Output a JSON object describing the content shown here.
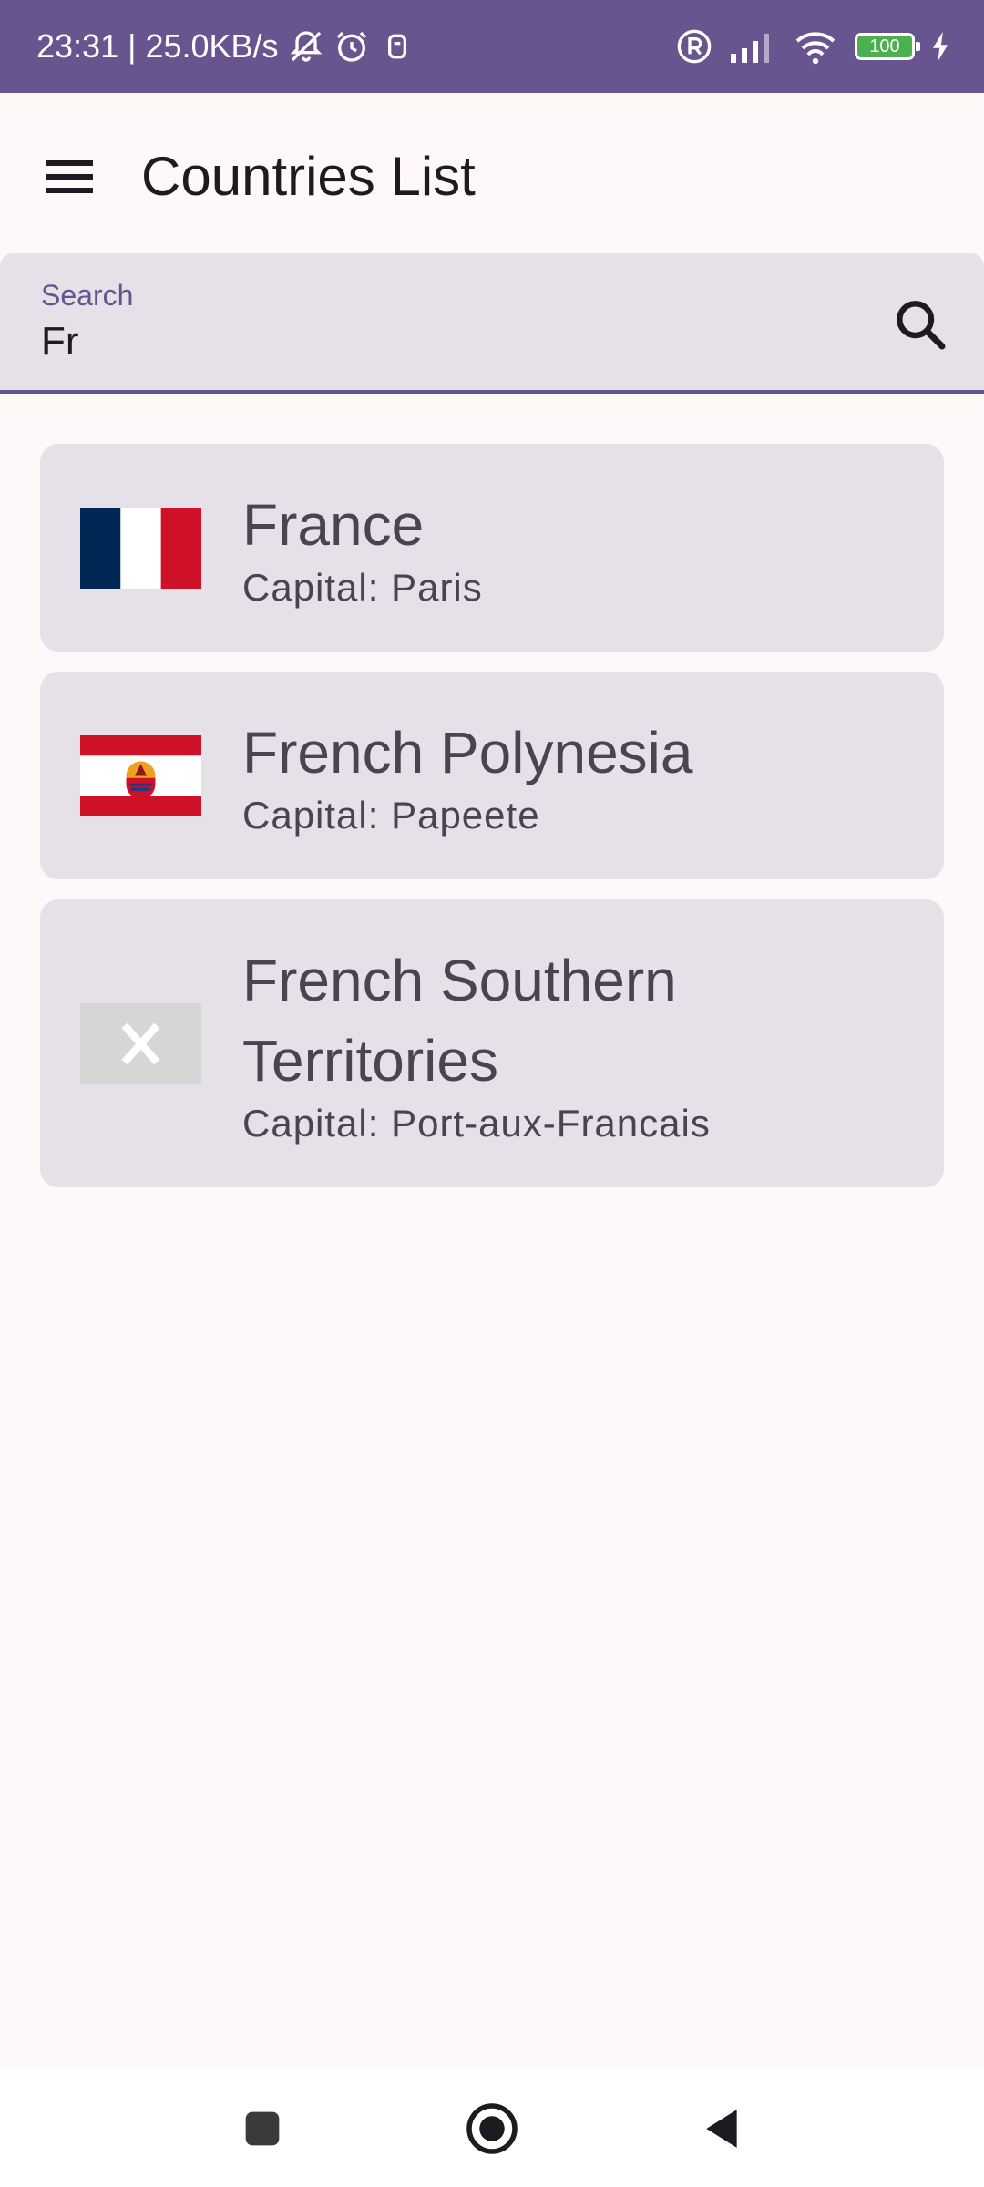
{
  "status_bar": {
    "time_speed": "23:31 | 25.0KB/s",
    "battery": "100",
    "icons": [
      "bell-off-icon",
      "alarm-icon",
      "app-icon",
      "registered-icon",
      "signal-icon",
      "wifi-icon",
      "battery-icon",
      "charging-icon"
    ]
  },
  "app_bar": {
    "title": "Countries List",
    "menu_icon": "menu-icon"
  },
  "search": {
    "label": "Search",
    "value": "Fr",
    "icon": "search-icon"
  },
  "countries": [
    {
      "name": "France",
      "capital": "Capital: Paris",
      "flag": "france-flag"
    },
    {
      "name": "French Polynesia",
      "capital": "Capital: Papeete",
      "flag": "french-polynesia-flag"
    },
    {
      "name": "French Southern Territories",
      "capital": "Capital: Port-aux-Francais",
      "flag": "missing-flag-placeholder"
    }
  ],
  "nav_bar": {
    "icons": [
      "recents-icon",
      "home-icon",
      "back-icon"
    ]
  },
  "colors": {
    "primary": "#68548E",
    "surface": "#FFF8F9",
    "card": "#E6E0E9",
    "france_blue": "#002654",
    "france_red": "#CE1126"
  }
}
